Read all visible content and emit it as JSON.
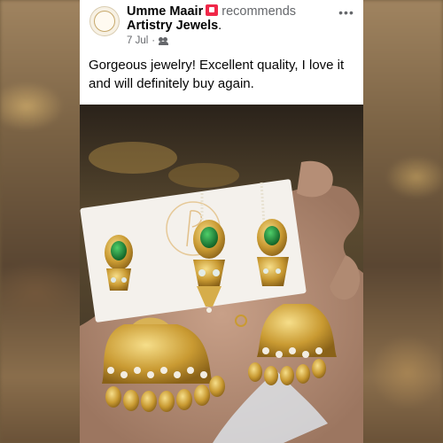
{
  "post": {
    "author": "Umme Maair",
    "action": "recommends",
    "page_name": "Artistry Jewels",
    "page_dot": ".",
    "date": "7 Jul",
    "date_sep": "·",
    "more_label": "•••",
    "text": "Gorgeous jewelry! Excellent quality, I love it and will definitely buy again."
  },
  "icons": {
    "recommend": "recommend-icon",
    "audience": "friends-icon",
    "more": "more-options-icon"
  },
  "colors": {
    "recommend": "#f02849",
    "secondary_text": "#65676b",
    "gold": "#c9a13a",
    "emerald": "#1f8a3a"
  }
}
